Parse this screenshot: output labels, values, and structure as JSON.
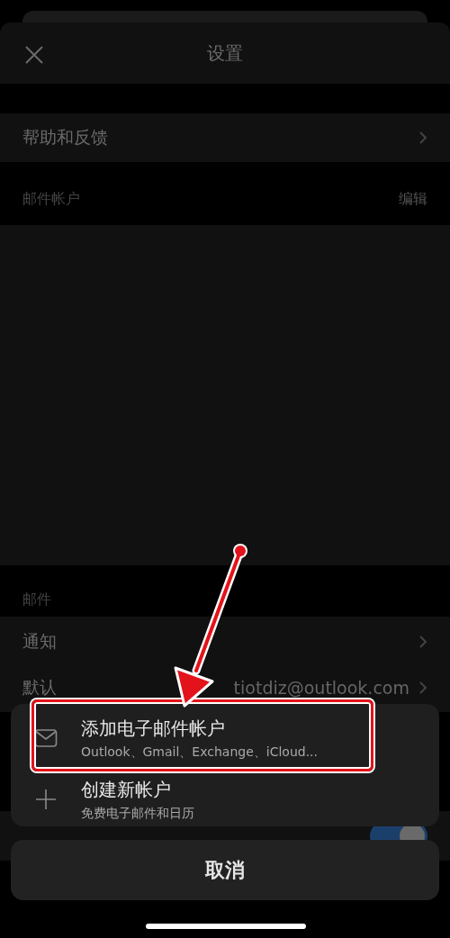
{
  "header": {
    "title": "设置"
  },
  "help_row": {
    "label": "帮助和反馈"
  },
  "accounts_section": {
    "title": "邮件帐户",
    "action": "编辑"
  },
  "mail_section": {
    "title": "邮件",
    "rows": [
      {
        "kind": "link",
        "label": "通知"
      },
      {
        "kind": "value",
        "label": "默认",
        "value": "tiotdiz@outlook.com"
      },
      {
        "kind": "toggle",
        "on": true
      }
    ]
  },
  "action_sheet": {
    "options": [
      {
        "kind": "mail",
        "title": "添加电子邮件帐户",
        "subtitle": "Outlook、Gmail、Exchange、iCloud...",
        "highlighted": true
      },
      {
        "kind": "add",
        "title": "创建新帐户",
        "subtitle": "免费电子邮件和日历",
        "highlighted": false
      }
    ],
    "cancel": "取消"
  }
}
